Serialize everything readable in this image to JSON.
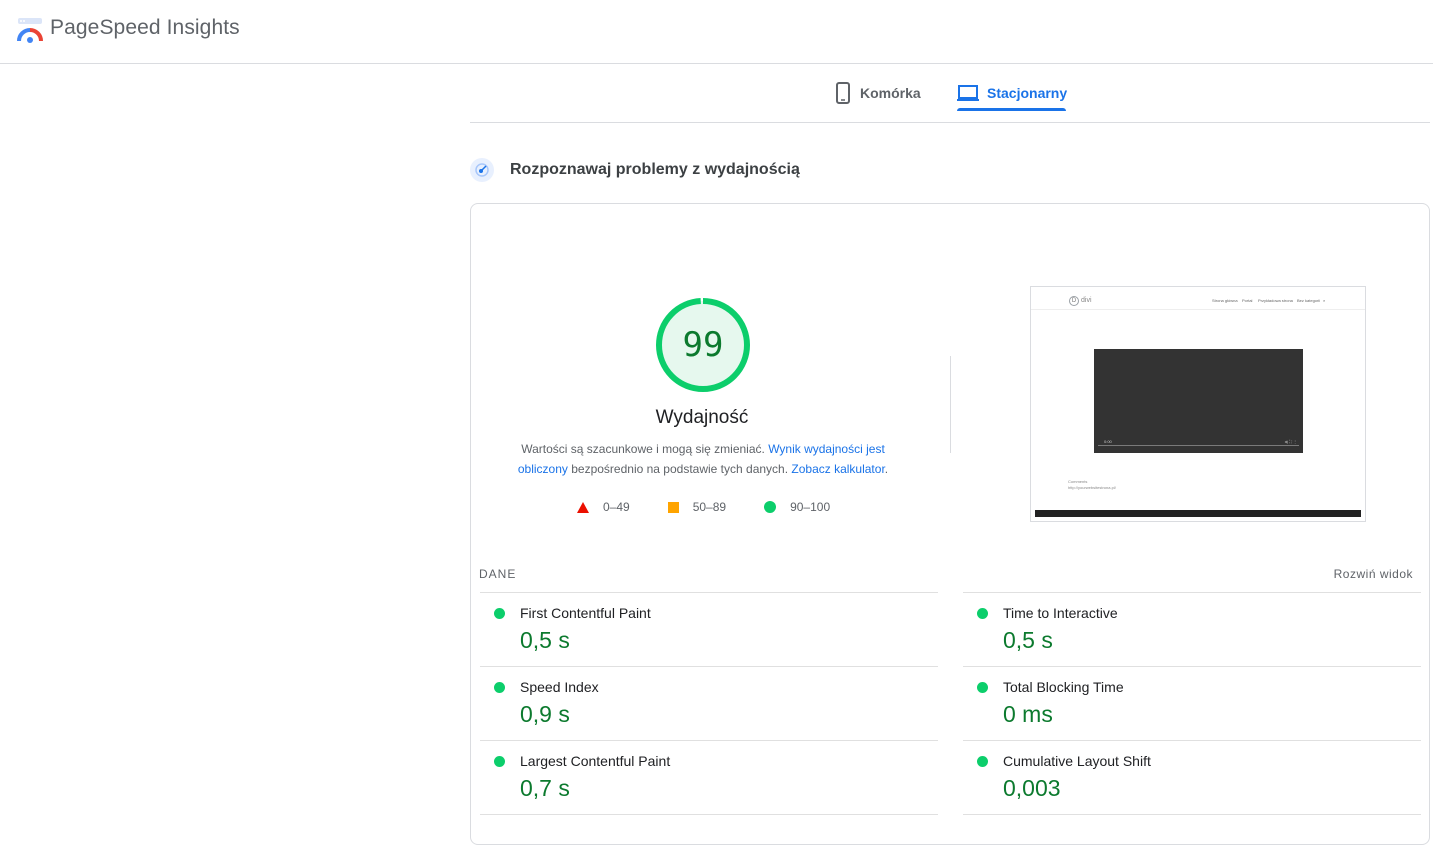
{
  "header": {
    "title": "PageSpeed Insights"
  },
  "tabs": [
    {
      "label": "Komórka",
      "active": false
    },
    {
      "label": "Stacjonarny",
      "active": true
    }
  ],
  "section": {
    "title": "Rozpoznawaj problemy z wydajnością"
  },
  "gauge": {
    "score": "99",
    "label": "Wydajność",
    "fraction": 0.99,
    "color": "#0cce6b"
  },
  "disclaimer": {
    "text1": "Wartości są szacunkowe i mogą się zmieniać. ",
    "link1": "Wynik wydajności jest obliczony",
    "text2": " bezpośrednio na podstawie tych danych. ",
    "link2": "Zobacz kalkulator",
    "text3": "."
  },
  "legend": {
    "fail": "0–49",
    "average": "50–89",
    "pass": "90–100"
  },
  "screenshot": {
    "logo_text": "divi",
    "logo_letter": "D",
    "nav": [
      "Strona główna",
      "Portal",
      "Przykładowa strona",
      "Bez kategorii"
    ],
    "video_time": "0:00",
    "text_lines": [
      "Comments",
      "http://yourwebsitestrona.pl/"
    ]
  },
  "metrics_header": {
    "label": "DANE",
    "expand": "Rozwiń widok"
  },
  "metrics": [
    {
      "name": "First Contentful Paint",
      "value": "0,5 s"
    },
    {
      "name": "Time to Interactive",
      "value": "0,5 s"
    },
    {
      "name": "Speed Index",
      "value": "0,9 s"
    },
    {
      "name": "Total Blocking Time",
      "value": "0 ms"
    },
    {
      "name": "Largest Contentful Paint",
      "value": "0,7 s"
    },
    {
      "name": "Cumulative Layout Shift",
      "value": "0,003"
    }
  ],
  "colors": {
    "accent": "#1a73e8",
    "pass": "#0cce6b",
    "pass_text": "#0c7a2e",
    "average": "#ffa400",
    "fail": "#eb0f00"
  }
}
